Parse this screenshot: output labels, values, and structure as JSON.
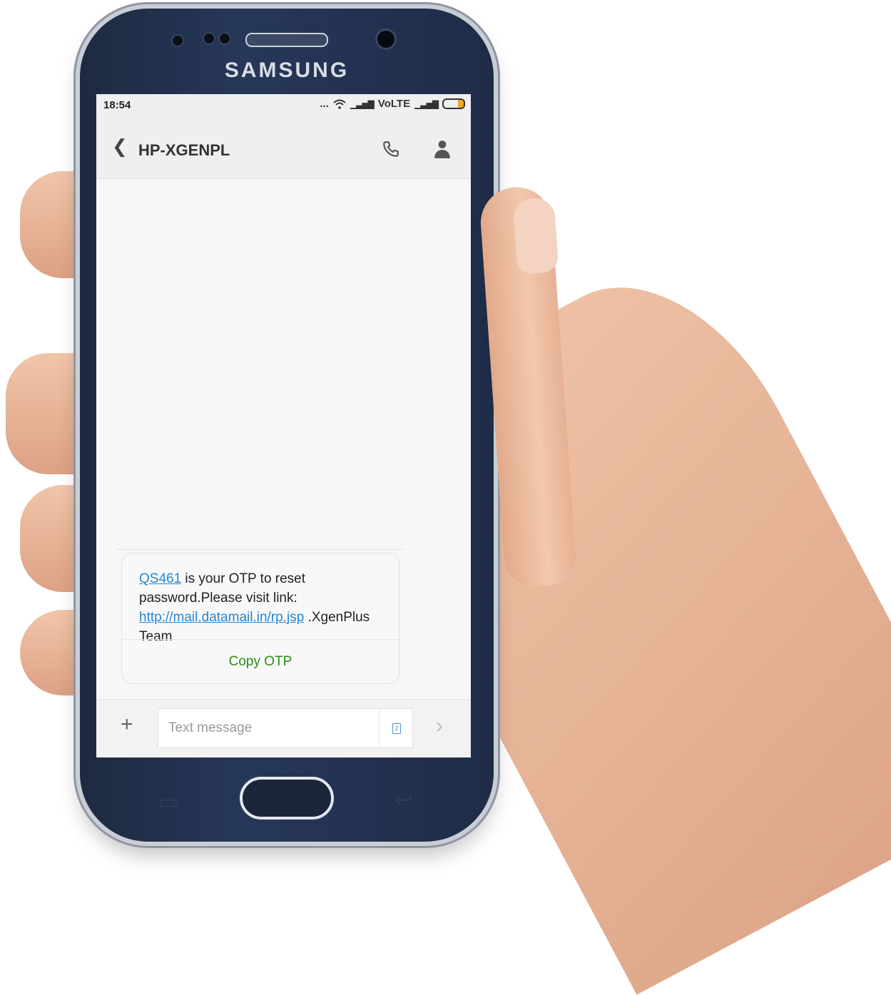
{
  "device": {
    "brand": "SAMSUNG"
  },
  "status_bar": {
    "time": "18:54",
    "dots": "...",
    "network": "VoLTE",
    "battery_level": 0.3
  },
  "conversation": {
    "title": "HP-XGENPL"
  },
  "message": {
    "otp": "QS461",
    "text_1": " is your OTP to reset password.Please visit link: ",
    "link": "http://mail.datamail.in/rp.jsp",
    "text_2": " .XgenPlus Team",
    "action": "Copy OTP"
  },
  "composer": {
    "placeholder": "Text message",
    "sim": "2"
  },
  "colors": {
    "link": "#1e88d6",
    "action": "#2e8b16",
    "phone_body": "#1d2a40"
  }
}
